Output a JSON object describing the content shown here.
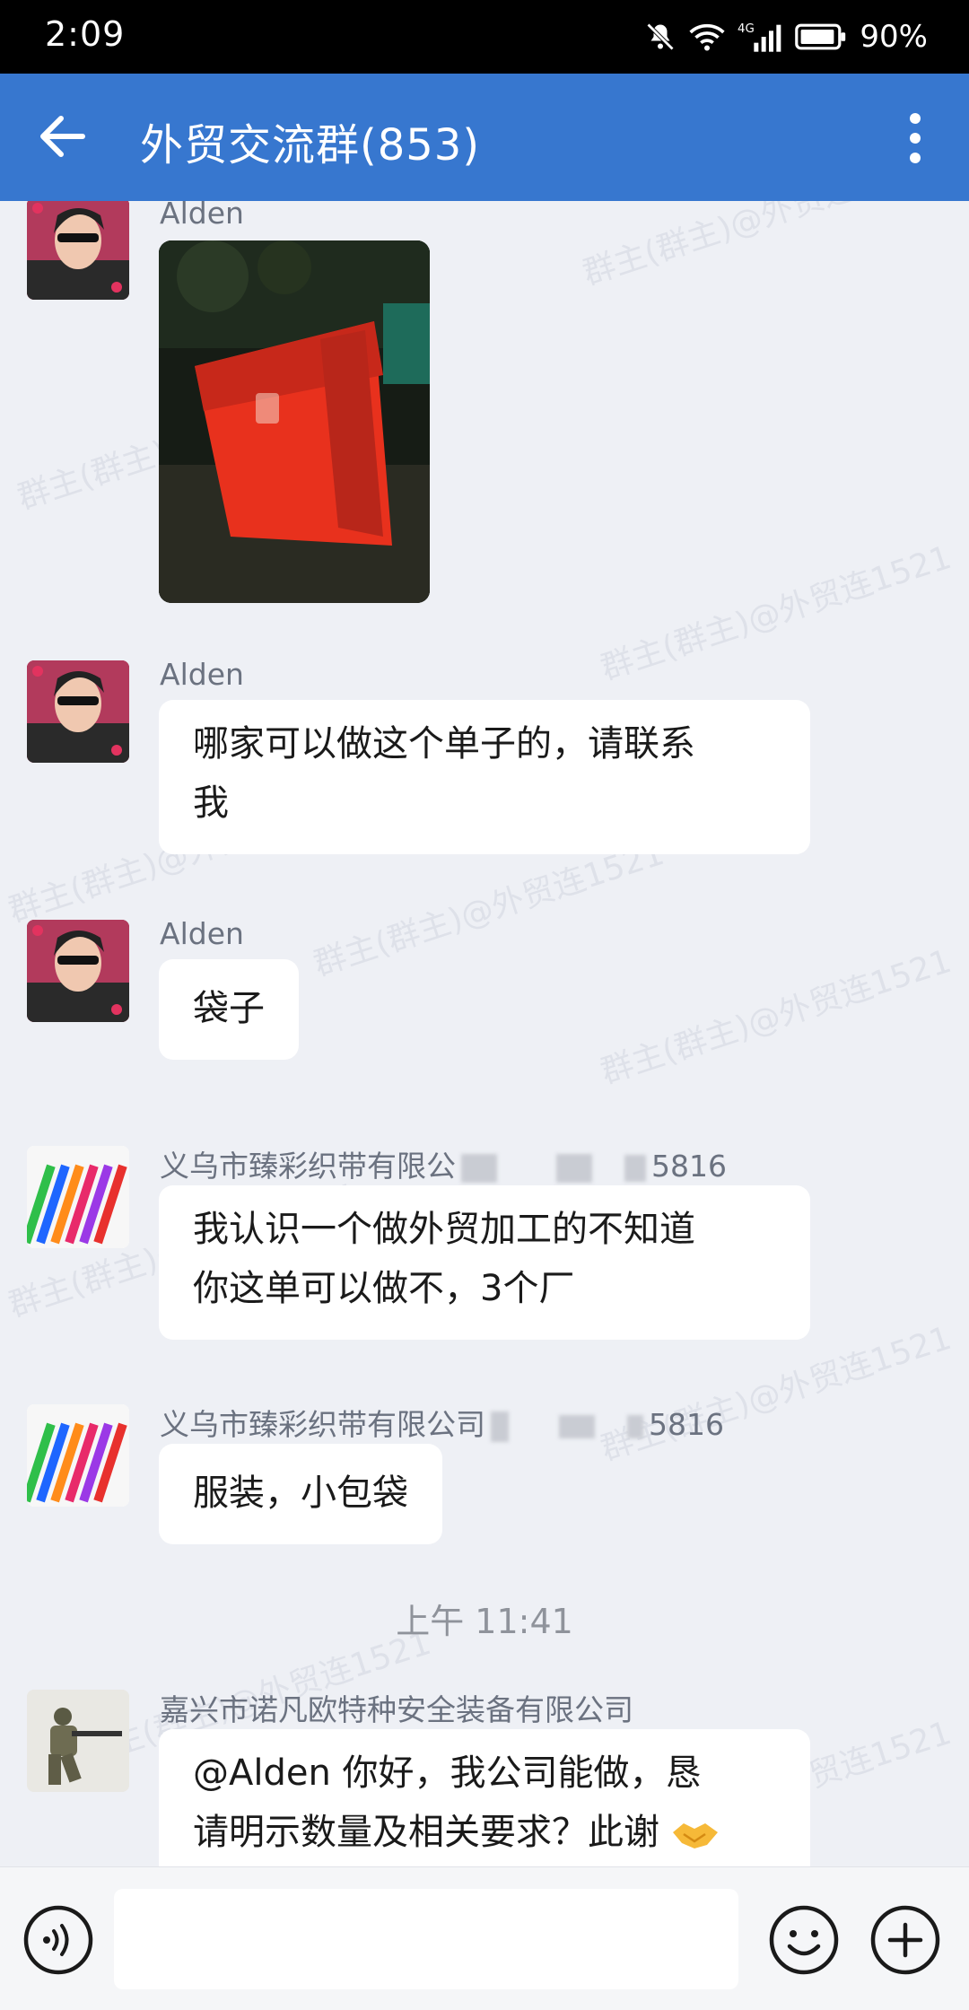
{
  "status_bar": {
    "time": "2:09",
    "network": "4G",
    "battery": "90%",
    "icons": [
      "bell-muted-icon",
      "wifi-icon",
      "cellular-signal-icon",
      "battery-icon"
    ]
  },
  "header": {
    "title": "外贸交流群(853)",
    "icons": [
      "back-arrow-icon",
      "more-vertical-icon"
    ]
  },
  "messages": [
    {
      "sender": "Alden",
      "type": "image"
    },
    {
      "sender": "Alden",
      "lines": [
        "哪家可以做这个单子的，请联系",
        "我"
      ]
    },
    {
      "sender": "Alden",
      "lines": [
        "袋子"
      ]
    },
    {
      "sender_visible": "义乌市臻彩织带有限公",
      "sender_suffix": "5816",
      "lines": [
        "我认识一个做外贸加工的不知道",
        "你这单可以做不，3个厂"
      ]
    },
    {
      "sender_visible": "义乌市臻彩织带有限公司",
      "sender_suffix": "5816",
      "lines": [
        "服装，小包袋"
      ]
    },
    {
      "sender": "嘉兴市诺凡欧特种安全装备有限公司",
      "lines": [
        "@Alden  你好，我公司能做，恳",
        "请明示数量及相关要求？此谢"
      ]
    }
  ],
  "time_divider": "上午 11:41",
  "watermark_text": "群主(群主)@外贸连1521",
  "input": {
    "placeholder": "",
    "icons": [
      "voice-icon",
      "emoji-icon",
      "plus-icon"
    ]
  },
  "colors": {
    "header_bg": "#3777cf",
    "chat_bg": "#eef0f5",
    "bubble_bg": "#ffffff"
  }
}
